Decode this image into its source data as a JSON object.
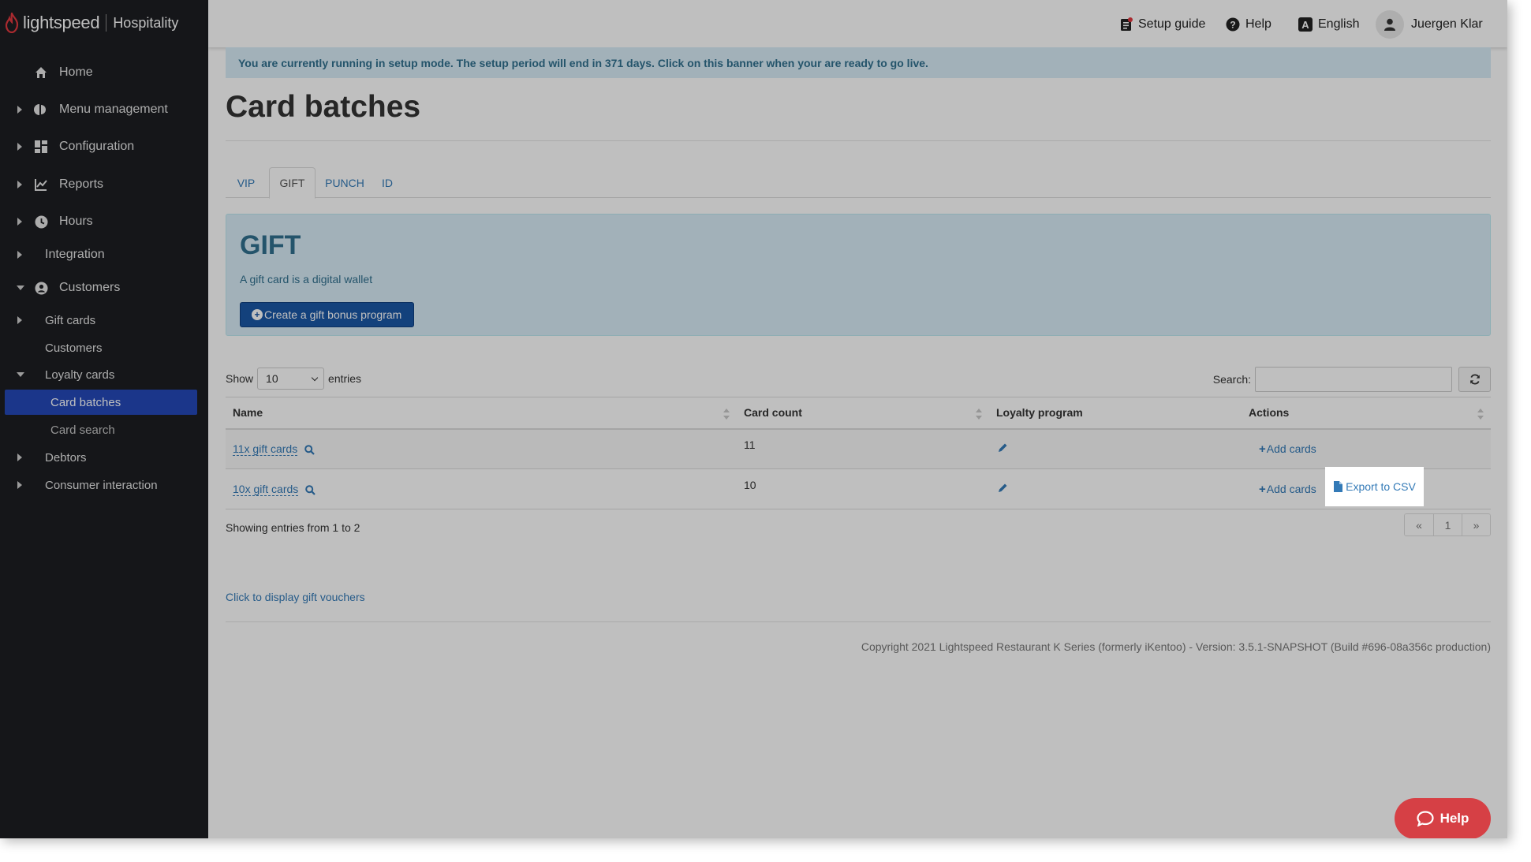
{
  "brand": {
    "name": "lightspeed",
    "product": "Hospitality"
  },
  "sidebar": {
    "items": [
      {
        "label": "Home",
        "icon": "home-icon",
        "caret": "none"
      },
      {
        "label": "Menu management",
        "icon": "menu-management-icon",
        "caret": "right"
      },
      {
        "label": "Configuration",
        "icon": "dashboard-grid-icon",
        "caret": "right"
      },
      {
        "label": "Reports",
        "icon": "chart-line-icon",
        "caret": "right"
      },
      {
        "label": "Hours",
        "icon": "clock-icon",
        "caret": "right"
      },
      {
        "label": "Integration",
        "icon": "",
        "caret": "right"
      },
      {
        "label": "Customers",
        "icon": "user-circle-icon",
        "caret": "down"
      }
    ],
    "sub_items": [
      {
        "label": "Gift cards",
        "caret": "right"
      },
      {
        "label": "Customers",
        "caret": "none"
      },
      {
        "label": "Loyalty cards",
        "caret": "down"
      },
      {
        "label": "Card batches",
        "active": true
      },
      {
        "label": "Card search",
        "active": false
      },
      {
        "label": "Debtors",
        "caret": "right"
      },
      {
        "label": "Consumer interaction",
        "caret": "right"
      }
    ]
  },
  "topbar": {
    "setup_guide": "Setup guide",
    "help": "Help",
    "language": "English",
    "user": "Juergen Klar"
  },
  "banner": {
    "text": "You are currently running in setup mode. The setup period will end in 371 days. Click on this banner when your are ready to go live."
  },
  "page": {
    "title": "Card batches"
  },
  "tabs": [
    {
      "label": "VIP",
      "active": false
    },
    {
      "label": "GIFT",
      "active": true
    },
    {
      "label": "PUNCH",
      "active": false
    },
    {
      "label": "ID",
      "active": false
    }
  ],
  "info": {
    "heading": "GIFT",
    "description": "A gift card is a digital wallet",
    "button": "Create a gift bonus program"
  },
  "table_controls": {
    "show_label": "Show",
    "page_size": "10",
    "entries_label": "entries",
    "search_label": "Search:"
  },
  "table": {
    "columns": [
      "Name",
      "Card count",
      "Loyalty program",
      "Actions"
    ],
    "rows": [
      {
        "name": "11x gift cards",
        "count": "11",
        "add_cards": "Add cards",
        "export": ""
      },
      {
        "name": "10x gift cards",
        "count": "10",
        "add_cards": "Add cards",
        "export": "Export to CSV"
      }
    ]
  },
  "footer_table": {
    "showing": "Showing entries from 1 to 2",
    "pager": {
      "prev": "«",
      "page": "1",
      "next": "»"
    }
  },
  "voucher_link": "Click to display gift vouchers",
  "copyright": "Copyright 2021 Lightspeed Restaurant K Series (formerly iKentoo) - Version: 3.5.1-SNAPSHOT (Build #696-08a356c production)",
  "help_fab": "Help",
  "colors": {
    "accent": "#2449b8",
    "sidebar": "#1c1e22",
    "brand_red": "#e2383f",
    "help_red": "#d64045"
  }
}
